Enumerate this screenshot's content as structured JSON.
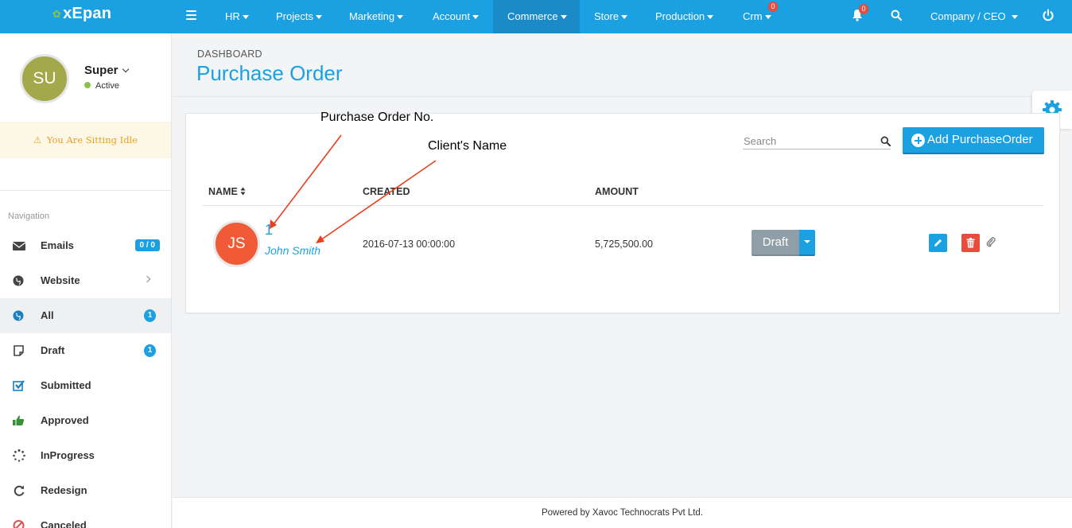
{
  "app": {
    "logo": "xEpan"
  },
  "topnav": {
    "items": [
      {
        "label": "HR"
      },
      {
        "label": "Projects"
      },
      {
        "label": "Marketing"
      },
      {
        "label": "Account"
      },
      {
        "label": "Commerce"
      },
      {
        "label": "Store"
      },
      {
        "label": "Production"
      },
      {
        "label": "Crm",
        "badge": "0"
      }
    ],
    "notifications_badge": "0",
    "user_menu": "Company / CEO"
  },
  "sidebar": {
    "user": {
      "initials": "SU",
      "name": "Super",
      "status": "Active"
    },
    "idle_message": "You Are Sitting Idle",
    "nav_title": "Navigation",
    "items": [
      {
        "label": "Emails",
        "count": "0 / 0"
      },
      {
        "label": "Website"
      },
      {
        "label": "All",
        "count": "1"
      },
      {
        "label": "Draft",
        "count": "1"
      },
      {
        "label": "Submitted"
      },
      {
        "label": "Approved"
      },
      {
        "label": "InProgress"
      },
      {
        "label": "Redesign"
      },
      {
        "label": "Canceled"
      }
    ]
  },
  "page": {
    "breadcrumb": "DASHBOARD",
    "title": "Purchase Order"
  },
  "grid": {
    "search_placeholder": "Search",
    "add_button": "Add PurchaseOrder",
    "columns": {
      "name": "NAME",
      "created": "CREATED",
      "amount": "AMOUNT"
    },
    "rows": [
      {
        "initials": "JS",
        "number": "1",
        "client": "John Smith",
        "created": "2016-07-13 00:00:00",
        "amount": "5,725,500.00",
        "status": "Draft"
      }
    ]
  },
  "annotations": {
    "po_number": "Purchase Order No.",
    "client_name": "Client's Name"
  },
  "footer": {
    "text": "Powered by Xavoc Technocrats Pvt Ltd."
  },
  "colors": {
    "primary": "#1ba1e2",
    "avatar_su": "#a3a84b",
    "avatar_js": "#f05a36",
    "danger": "#e74c3c",
    "status_draft": "#8f9ea7",
    "idle_bg": "#fdf7e6",
    "idle_text": "#e6a223"
  }
}
